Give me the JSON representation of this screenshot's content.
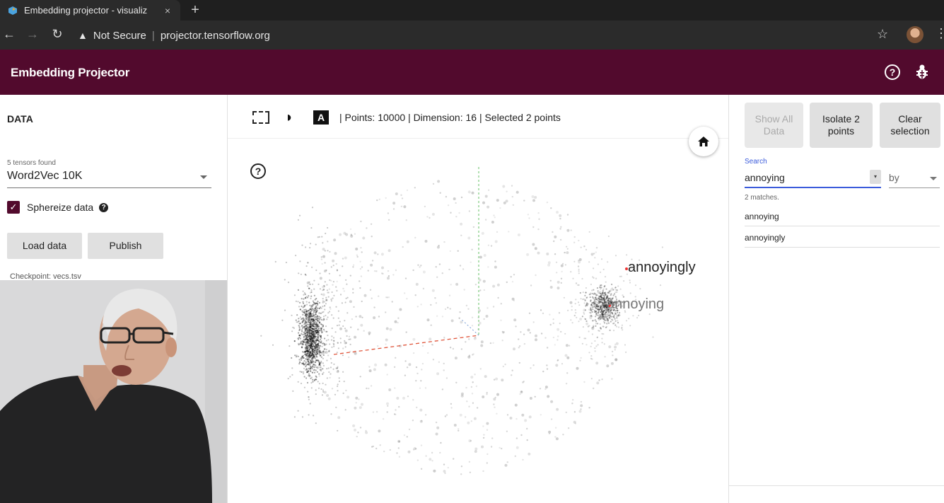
{
  "browser": {
    "tab_title": "Embedding projector - visualiz",
    "tab_close": "×",
    "new_tab": "+",
    "security_label": "Not Secure",
    "url": "projector.tensorflow.org"
  },
  "app": {
    "title": "Embedding Projector",
    "help_icon_label": "?",
    "header_color": "#520a2d"
  },
  "data_panel": {
    "section_title": "DATA",
    "tensors_found": "5 tensors found",
    "selected_tensor": "Word2Vec 10K",
    "sphereize_label": "Sphereize data",
    "sphereize_checked": true,
    "load_button": "Load data",
    "publish_button": "Publish",
    "checkpoint": "Checkpoint: vecs.tsv"
  },
  "projection": {
    "stats": "| Points: 10000 | Dimension: 16 | Selected 2 points",
    "label_toggle": "A",
    "help_label": "?",
    "labels": [
      "annoyingly",
      "annoying"
    ]
  },
  "inspector": {
    "show_all_button": "Show All Data",
    "isolate_button": "Isolate 2 points",
    "clear_button": "Clear selection",
    "search_label": "Search",
    "search_value": "annoying",
    "by_label": "by",
    "matches": "2 matches.",
    "results": [
      "annoying",
      "annoyingly"
    ]
  }
}
